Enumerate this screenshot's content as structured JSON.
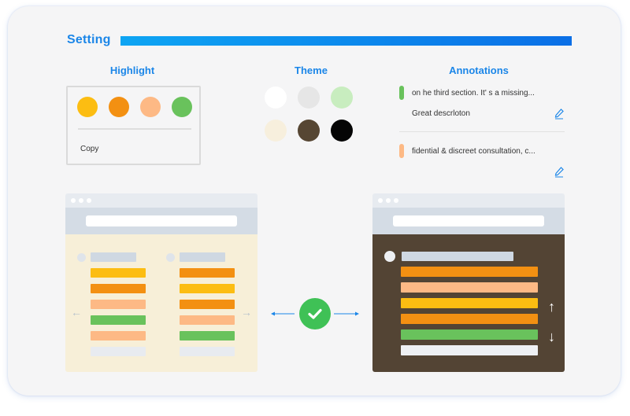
{
  "header": {
    "title": "Setting"
  },
  "highlight": {
    "label": "Highlight",
    "colors": [
      "#fcbd12",
      "#f39012",
      "#fdb985",
      "#69c25c"
    ],
    "copy_label": "Copy"
  },
  "theme": {
    "label": "Theme",
    "colors": [
      "#ffffff",
      "#e6e6e6",
      "#c8edbf",
      "#f7efdd",
      "#564633",
      "#050505"
    ]
  },
  "annotations": {
    "label": "Annotations",
    "items": [
      {
        "color": "#69c25c",
        "text": "on he third section. It' s a missing...",
        "note": "Great descrloton"
      },
      {
        "color": "#fdb985",
        "text": "fidential & discreet consultation, c...",
        "note": ""
      }
    ]
  },
  "preview_light": {
    "background": "#f7efd8",
    "left_column": [
      "#fcbd12",
      "#f39012",
      "#fdb985",
      "#69c25c",
      "#fdb985",
      "#e8ebf0"
    ],
    "right_column": [
      "#f39012",
      "#fcbd12",
      "#f39012",
      "#fdb985",
      "#69c25c",
      "#e8ebf0"
    ]
  },
  "preview_dark": {
    "background": "#534434",
    "rows": [
      "#f39012",
      "#fdb985",
      "#fcbd12",
      "#f39012",
      "#69c25c",
      "#eef0f3"
    ]
  },
  "icons": {
    "arrow_left": "←",
    "arrow_right": "→",
    "arrow_up": "↑",
    "arrow_down": "↓"
  }
}
